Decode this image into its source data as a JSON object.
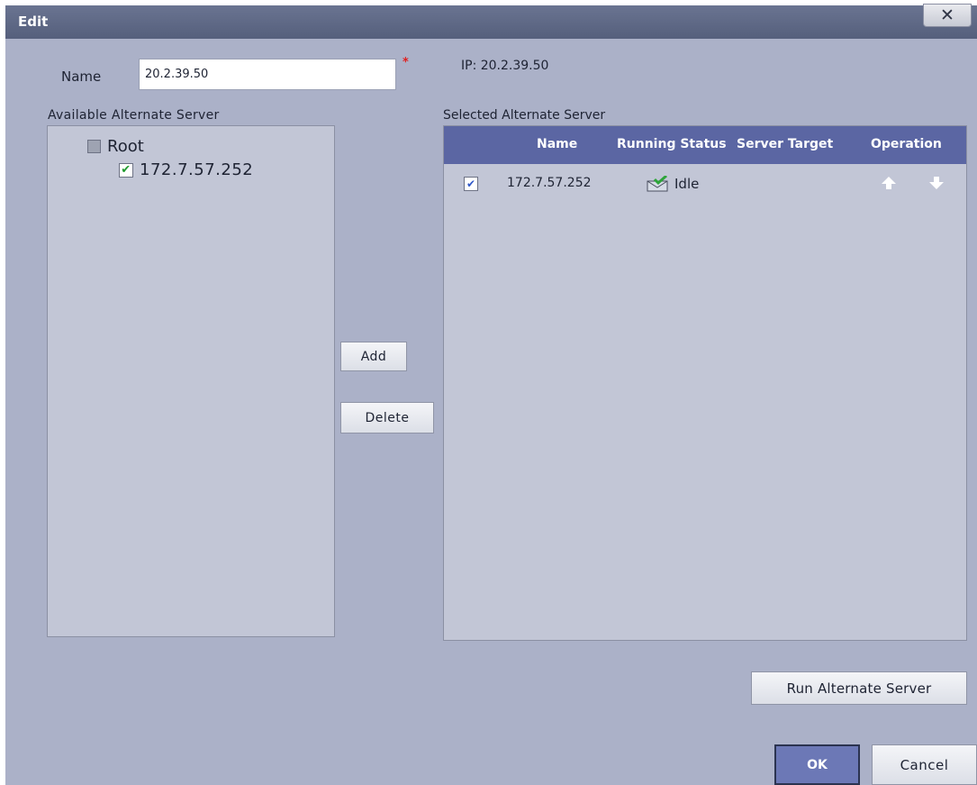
{
  "dialog": {
    "title": "Edit",
    "close_label": "✕"
  },
  "form": {
    "name_label": "Name",
    "name_value": "20.2.39.50",
    "required_marker": "*",
    "ip_text": "IP: 20.2.39.50"
  },
  "available": {
    "label": "Available Alternate Server",
    "tree": {
      "root_label": "Root",
      "child_label": "172.7.57.252"
    }
  },
  "selected": {
    "label": "Selected Alternate Server",
    "columns": [
      "Name",
      "Running Status",
      "Server Target",
      "Operation"
    ],
    "rows": [
      {
        "checked": true,
        "name": "172.7.57.252",
        "status": "Idle",
        "target": ""
      }
    ]
  },
  "buttons": {
    "add": "Add",
    "delete": "Delete",
    "run": "Run Alternate Server",
    "ok": "OK",
    "cancel": "Cancel"
  },
  "colors": {
    "header": "#5b66a3",
    "dialog_bg": "#abb1c8",
    "check_green": "#1f9a2e"
  }
}
